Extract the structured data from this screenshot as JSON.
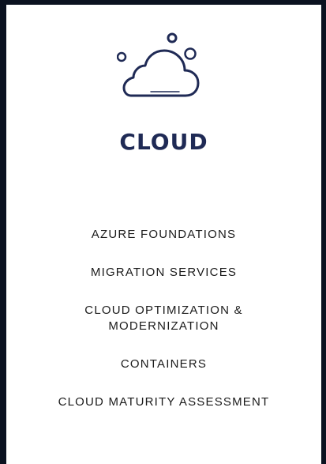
{
  "brand_color": "#1f2a55",
  "header": {
    "icon": "cloud-icon",
    "title": "CLOUD"
  },
  "menu": {
    "items": [
      {
        "label": "AZURE FOUNDATIONS"
      },
      {
        "label": "MIGRATION SERVICES"
      },
      {
        "label": "CLOUD OPTIMIZATION &\nMODERNIZATION"
      },
      {
        "label": "CONTAINERS"
      },
      {
        "label": "CLOUD MATURITY ASSESSMENT"
      }
    ]
  }
}
